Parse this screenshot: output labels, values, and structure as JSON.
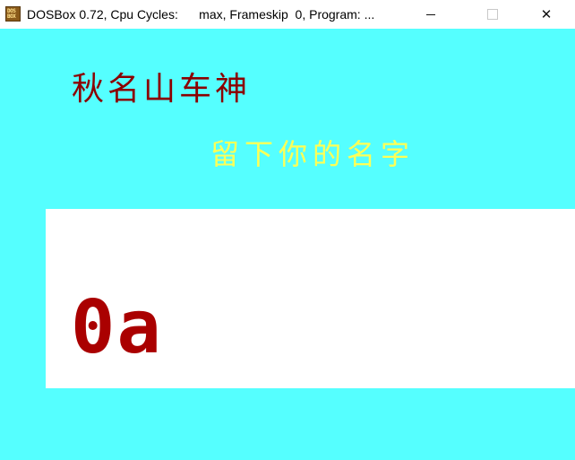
{
  "window": {
    "title": "DOSBox 0.72, Cpu Cycles:      max, Frameskip  0, Program: ...",
    "icon": "dosbox-icon",
    "icon_text_line1": "DOS",
    "icon_text_line2": "BOX",
    "controls": {
      "minimize": "minimize-icon",
      "maximize": "maximize-icon",
      "close": "✕"
    }
  },
  "screen": {
    "background": "#55ffff",
    "title": "秋名山车神",
    "title_color": "#8b0000",
    "subtitle": "留下你的名字",
    "subtitle_color": "#ffff55",
    "name_input_value": "0a",
    "name_input_color": "#aa0000"
  }
}
